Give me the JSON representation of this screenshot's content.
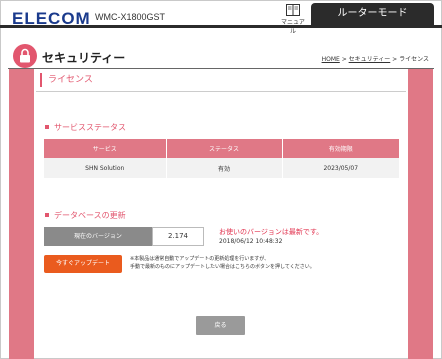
{
  "header": {
    "logo": "ELECOM",
    "model": "WMC-X1800GST",
    "manual_label": "マニュアル",
    "mode_label": "ルーターモード"
  },
  "page": {
    "title": "セキュリティー",
    "breadcrumb": [
      "HOME",
      "セキュリティー",
      "ライセンス"
    ],
    "breadcrumb_separator": " > "
  },
  "section": {
    "title": "ライセンス"
  },
  "service_status": {
    "title": "サービスステータス",
    "columns": [
      "サービス",
      "ステータス",
      "有効期限"
    ],
    "rows": [
      [
        "SHN Solution",
        "有効",
        "2023/05/07"
      ]
    ]
  },
  "database_update": {
    "title": "データベースの更新",
    "current_version_label": "現在のバージョン",
    "current_version_value": "2.174",
    "latest_message": "お使いのバージョンは最新です。",
    "timestamp": "2018/06/12 10:48:32",
    "update_button": "今すぐアップデート",
    "note_lines": [
      "※本製品は通常自動でアップデートの更新処理を行いますが、",
      "手動で最新のものにアップデートしたい場合はこちらのボタンを押してください。"
    ]
  },
  "footer": {
    "back_button": "戻る"
  },
  "colors": {
    "accent_pink": "#e2566e",
    "band_pink": "#e07886",
    "update_orange": "#ea5b1e",
    "header_dark": "#2b2b2b",
    "logo_blue": "#1a3a8c"
  },
  "icons": {
    "manual": "book-icon",
    "page": "lock-icon"
  }
}
